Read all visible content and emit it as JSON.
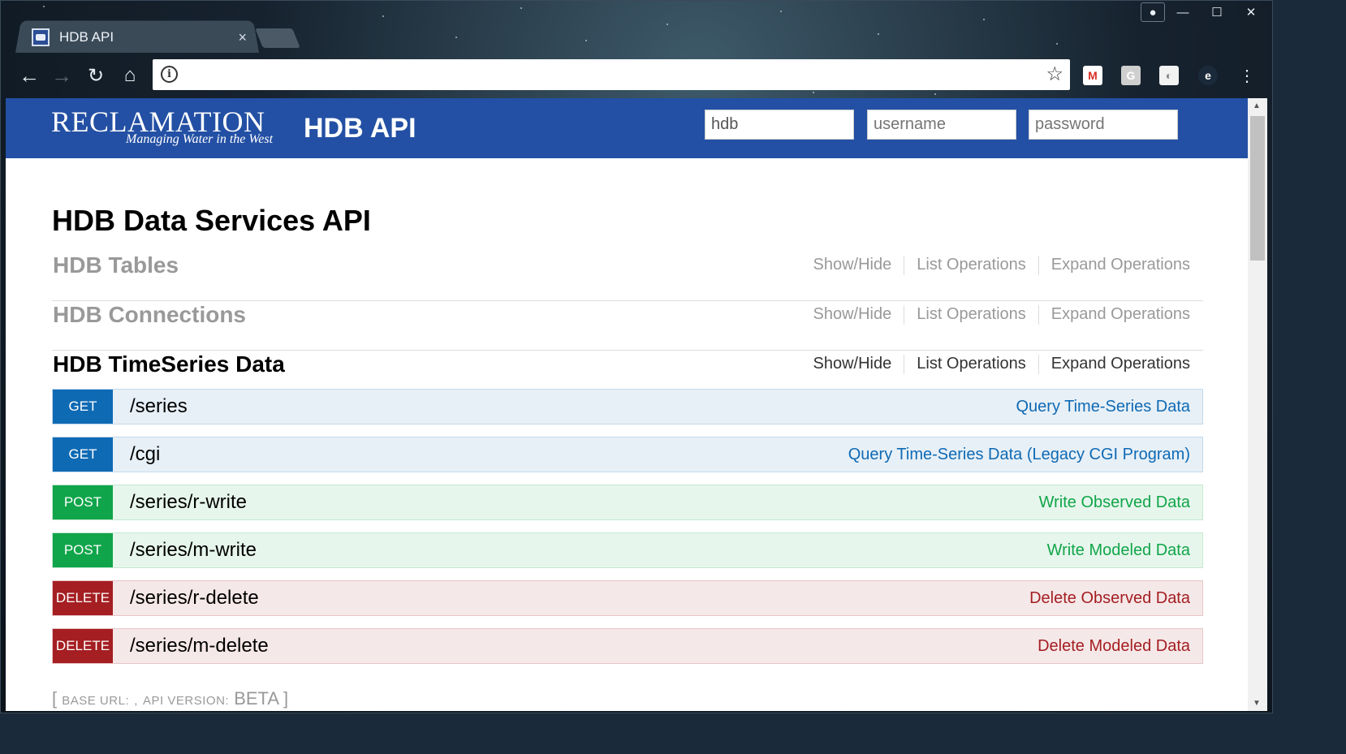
{
  "browser": {
    "tab_title": "HDB API",
    "tab_close": "×",
    "url": "",
    "window_controls": [
      "user-icon",
      "minimize-icon",
      "maximize-icon",
      "close-icon"
    ],
    "extensions": [
      "gmail-icon",
      "g-extension-icon",
      "shape-extension-icon",
      "e-extension-icon"
    ]
  },
  "header": {
    "logo_main": "RECLAMATION",
    "logo_tagline": "Managing Water in the West",
    "title": "HDB API",
    "inputs": {
      "db": {
        "value": "hdb",
        "placeholder": "hdb"
      },
      "username": {
        "placeholder": "username"
      },
      "password": {
        "placeholder": "password"
      }
    }
  },
  "main": {
    "title": "HDB Data Services API",
    "ops_labels": {
      "show_hide": "Show/Hide",
      "list": "List Operations",
      "expand": "Expand Operations"
    },
    "sections": [
      {
        "name": "HDB Tables"
      },
      {
        "name": "HDB Connections"
      },
      {
        "name": "HDB TimeSeries Data"
      }
    ],
    "endpoints": [
      {
        "method": "GET",
        "path": "/series",
        "summary": "Query Time-Series Data"
      },
      {
        "method": "GET",
        "path": "/cgi",
        "summary": "Query Time-Series Data (Legacy CGI Program)"
      },
      {
        "method": "POST",
        "path": "/series/r-write",
        "summary": "Write Observed Data"
      },
      {
        "method": "POST",
        "path": "/series/m-write",
        "summary": "Write Modeled Data"
      },
      {
        "method": "DELETE",
        "path": "/series/r-delete",
        "summary": "Delete Observed Data"
      },
      {
        "method": "DELETE",
        "path": "/series/m-delete",
        "summary": "Delete Modeled Data"
      }
    ],
    "footer": {
      "open": "[",
      "base_url_label": "base url:",
      "base_url_value": ",",
      "api_version_label": "api version:",
      "api_version_value": "BETA",
      "close": "]"
    }
  },
  "colors": {
    "header_bg": "#2350a4",
    "get": "#0f6ab4",
    "post": "#10a54a",
    "delete": "#a41e22"
  }
}
